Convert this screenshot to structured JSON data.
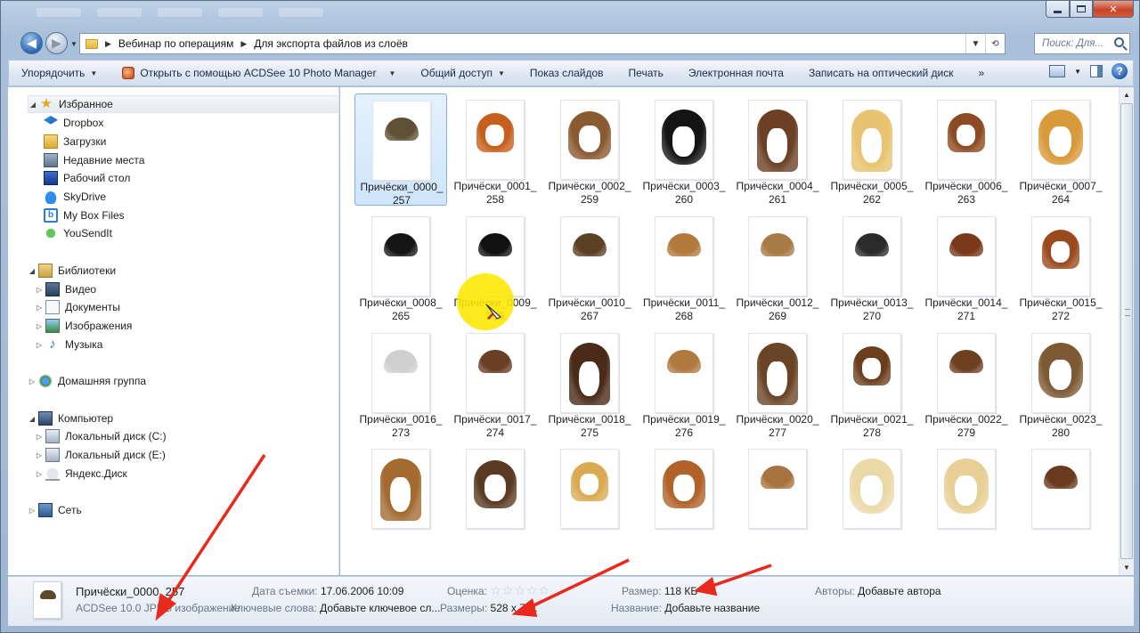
{
  "address": {
    "crumbs": [
      "Вебинар по операциям",
      "Для экспорта файлов из слоёв"
    ],
    "search_placeholder": "Поиск: Для..."
  },
  "toolbar": {
    "organize": "Упорядочить",
    "open_with": "Открыть с помощью ACDSee 10 Photo Manager",
    "share": "Общий доступ",
    "slideshow": "Показ слайдов",
    "print": "Печать",
    "email": "Электронная почта",
    "burn": "Записать на оптический диск",
    "more": "»"
  },
  "nav": {
    "favorites_header": "Избранное",
    "favorites": [
      "Dropbox",
      "Загрузки",
      "Недавние места",
      "Рабочий стол",
      "SkyDrive",
      "My Box Files",
      "YouSendIt"
    ],
    "libraries_header": "Библиотеки",
    "libraries": [
      "Видео",
      "Документы",
      "Изображения",
      "Музыка"
    ],
    "homegroup": "Домашняя группа",
    "computer_header": "Компьютер",
    "drives": [
      "Локальный диск (C:)",
      "Локальный диск (E:)",
      "Яндекс.Диск"
    ],
    "network": "Сеть"
  },
  "files": [
    {
      "line1": "Причёски_0000_",
      "line2": "257",
      "hair": "#5e5136",
      "style": "short"
    },
    {
      "line1": "Причёски_0001_",
      "line2": "258",
      "hair": "#c65e1c",
      "style": "bob"
    },
    {
      "line1": "Причёски_0002_",
      "line2": "259",
      "hair": "#8a5a30",
      "style": "mid"
    },
    {
      "line1": "Причёски_0003_",
      "line2": "260",
      "hair": "#141414",
      "style": "curly"
    },
    {
      "line1": "Причёски_0004_",
      "line2": "261",
      "hair": "#6b4024",
      "style": "long"
    },
    {
      "line1": "Причёски_0005_",
      "line2": "262",
      "hair": "#e8c370",
      "style": "long"
    },
    {
      "line1": "Причёски_0006_",
      "line2": "263",
      "hair": "#8e4a22",
      "style": "bob"
    },
    {
      "line1": "Причёски_0007_",
      "line2": "264",
      "hair": "#d99a3a",
      "style": "curly"
    },
    {
      "line1": "Причёски_0008_",
      "line2": "265",
      "hair": "#151515",
      "style": "short"
    },
    {
      "line1": "Причёски_0009_",
      "line2": "266",
      "hair": "#111111",
      "style": "short"
    },
    {
      "line1": "Причёски_0010_",
      "line2": "267",
      "hair": "#5c4024",
      "style": "short"
    },
    {
      "line1": "Причёски_0011_",
      "line2": "268",
      "hair": "#b27a3c",
      "style": "short"
    },
    {
      "line1": "Причёски_0012_",
      "line2": "269",
      "hair": "#a87a45",
      "style": "short"
    },
    {
      "line1": "Причёски_0013_",
      "line2": "270",
      "hair": "#2b2b2b",
      "style": "short"
    },
    {
      "line1": "Причёски_0014_",
      "line2": "271",
      "hair": "#7a3a1a",
      "style": "short"
    },
    {
      "line1": "Причёски_0015_",
      "line2": "272",
      "hair": "#9a4a1e",
      "style": "bob"
    },
    {
      "line1": "Причёски_0016_",
      "line2": "273",
      "hair": "#cfcfcf",
      "style": "short"
    },
    {
      "line1": "Причёски_0017_",
      "line2": "274",
      "hair": "#6a4024",
      "style": "short"
    },
    {
      "line1": "Причёски_0018_",
      "line2": "275",
      "hair": "#4a2a18",
      "style": "long"
    },
    {
      "line1": "Причёски_0019_",
      "line2": "276",
      "hair": "#b07a3e",
      "style": "short"
    },
    {
      "line1": "Причёски_0020_",
      "line2": "277",
      "hair": "#6a4426",
      "style": "long"
    },
    {
      "line1": "Причёски_0021_",
      "line2": "278",
      "hair": "#6b3f1e",
      "style": "bob"
    },
    {
      "line1": "Причёски_0022_",
      "line2": "279",
      "hair": "#6e4020",
      "style": "short"
    },
    {
      "line1": "Причёски_0023_",
      "line2": "280",
      "hair": "#7e5a34",
      "style": "curly"
    },
    {
      "line1": "",
      "line2": "",
      "hair": "#a46a30",
      "style": "long"
    },
    {
      "line1": "",
      "line2": "",
      "hair": "#5a3a22",
      "style": "mid"
    },
    {
      "line1": "",
      "line2": "",
      "hair": "#d9aa50",
      "style": "bob"
    },
    {
      "line1": "",
      "line2": "",
      "hair": "#b0622a",
      "style": "mid"
    },
    {
      "line1": "",
      "line2": "",
      "hair": "#a7733e",
      "style": "short"
    },
    {
      "line1": "",
      "line2": "",
      "hair": "#ecd9a8",
      "style": "curly"
    },
    {
      "line1": "",
      "line2": "",
      "hair": "#e8cf95",
      "style": "curly"
    },
    {
      "line1": "",
      "line2": "",
      "hair": "#6a3a1c",
      "style": "short"
    }
  ],
  "selected_index": 0,
  "details": {
    "filename": "Причёски_0000_257",
    "filetype": "ACDSee 10.0 JPEG изображение",
    "date_label": "Дата съемки:",
    "date_value": "17.06.2006 10:09",
    "keywords_label": "Ключевые слова:",
    "keywords_value": "Добавьте ключевое сл...",
    "rating_label": "Оценка:",
    "rating_stars": 0,
    "dims_label": "Размеры:",
    "dims_value": "528 x 731",
    "size_label": "Размер:",
    "size_value": "118 КБ",
    "title_label": "Название:",
    "title_value": "Добавьте название",
    "authors_label": "Авторы:",
    "authors_value": "Добавьте автора"
  },
  "colors": {
    "annotation_arrow": "#e8291c",
    "cursor_highlight": "#ffe600",
    "selection": "#cfe5fb"
  }
}
